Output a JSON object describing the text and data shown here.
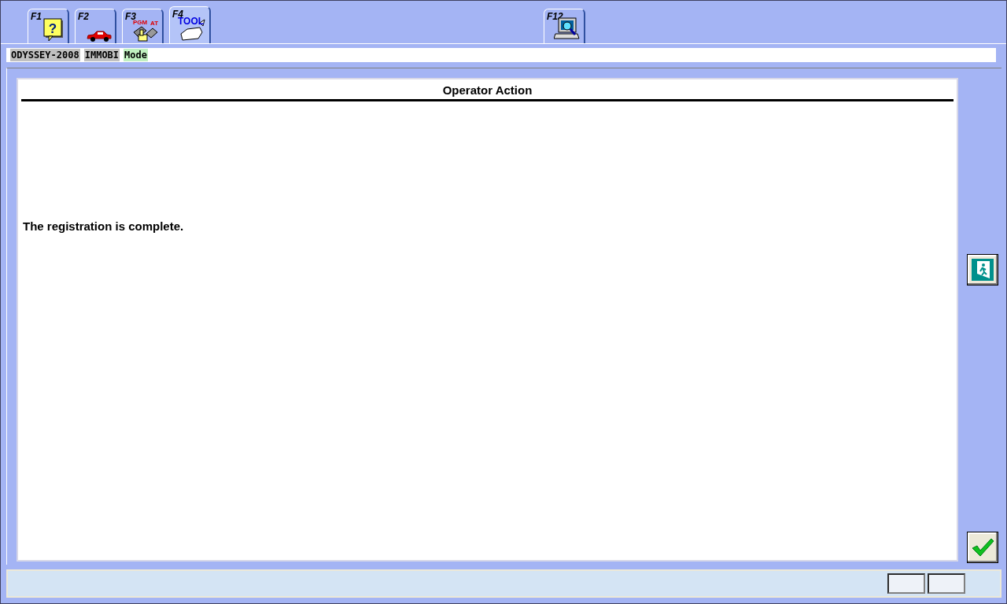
{
  "tabs": [
    {
      "key": "F1",
      "kind": "help",
      "icon_text": [
        "?"
      ],
      "selected": false
    },
    {
      "key": "F2",
      "kind": "car",
      "selected": false
    },
    {
      "key": "F3",
      "kind": "program",
      "icon_text": [
        "PGM",
        "AT"
      ],
      "selected": false
    },
    {
      "key": "F4",
      "kind": "tool",
      "icon_text": [
        "TOOL"
      ],
      "selected": true
    },
    {
      "key": "F12",
      "kind": "computer",
      "selected": false
    }
  ],
  "breadcrumbs": [
    {
      "label": "ODYSSEY-2008",
      "color": "#c0c0c0"
    },
    {
      "label": "IMMOBI",
      "color": "#c0c0c0"
    },
    {
      "label": "Mode",
      "color": "#c0f0c0"
    }
  ],
  "panel": {
    "title": "Operator Action",
    "message": "The registration is complete."
  },
  "side_buttons": [
    {
      "kind": "exit"
    },
    {
      "kind": "confirm"
    }
  ]
}
